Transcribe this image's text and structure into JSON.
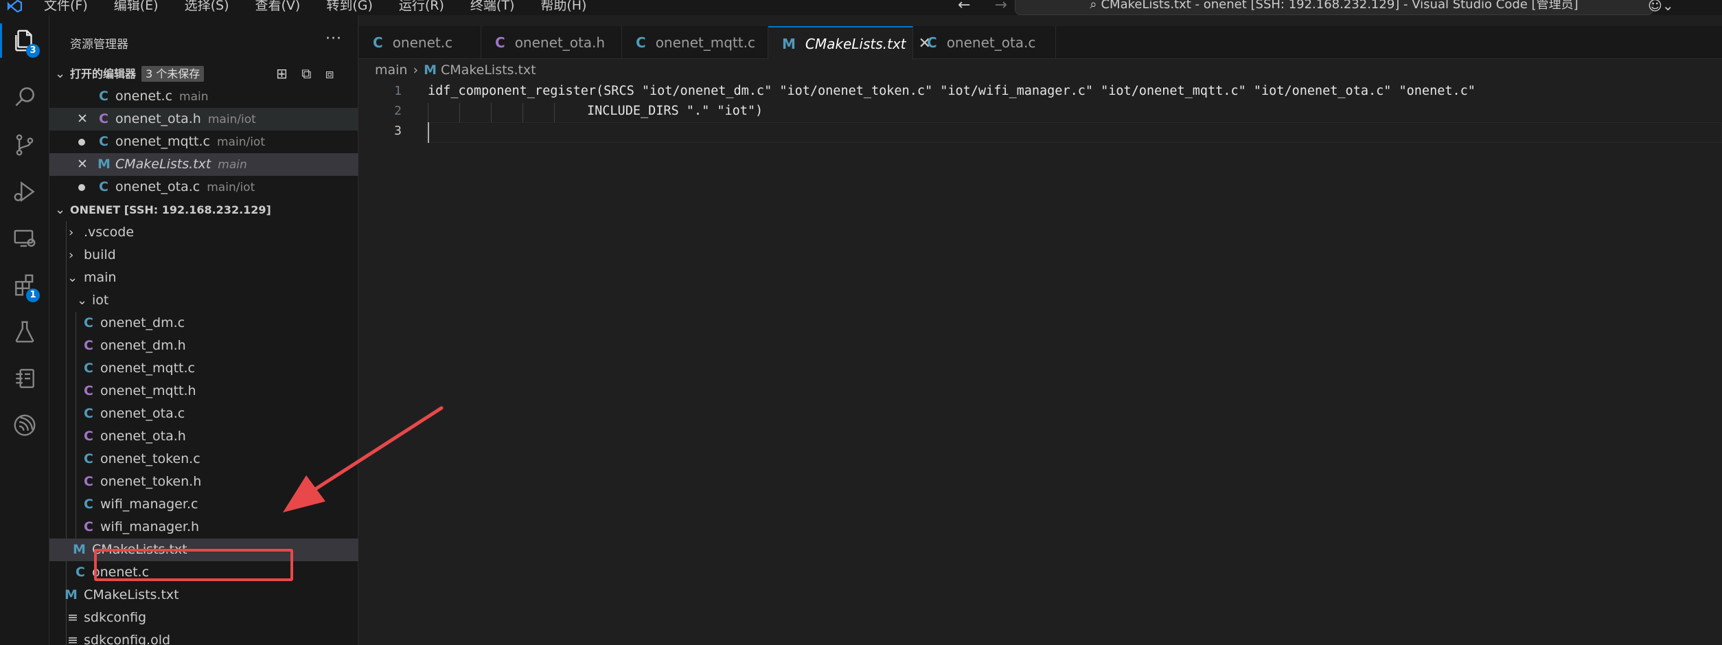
{
  "titlebar": {
    "menu": [
      "文件(F)",
      "编辑(E)",
      "选择(S)",
      "查看(V)",
      "转到(G)",
      "运行(R)",
      "终端(T)",
      "帮助(H)"
    ],
    "command_center": "CMakeLists.txt - onenet [SSH: 192.168.232.129] - Visual Studio Code [管理员]"
  },
  "activity": {
    "explorer_badge": "3",
    "extensions_badge": "1"
  },
  "sidebar": {
    "title": "资源管理器",
    "more": "···",
    "open_editors": {
      "label": "打开的编辑器",
      "unsaved": "3 个未保存",
      "items": [
        {
          "name": "onenet.c",
          "desc": "main"
        },
        {
          "name": "onenet_ota.h",
          "desc": "main/iot"
        },
        {
          "name": "onenet_mqtt.c",
          "desc": "main/iot"
        },
        {
          "name": "CMakeLists.txt",
          "desc": "main"
        },
        {
          "name": "onenet_ota.c",
          "desc": "main/iot"
        }
      ]
    },
    "workspace": {
      "label": "ONENET [SSH: 192.168.232.129]",
      "tree": [
        {
          "name": ".vscode"
        },
        {
          "name": "build"
        },
        {
          "name": "main"
        },
        {
          "name": "iot"
        },
        {
          "name": "onenet_dm.c"
        },
        {
          "name": "onenet_dm.h"
        },
        {
          "name": "onenet_mqtt.c"
        },
        {
          "name": "onenet_mqtt.h"
        },
        {
          "name": "onenet_ota.c"
        },
        {
          "name": "onenet_ota.h"
        },
        {
          "name": "onenet_token.c"
        },
        {
          "name": "onenet_token.h"
        },
        {
          "name": "wifi_manager.c"
        },
        {
          "name": "wifi_manager.h"
        },
        {
          "name": "CMakeLists.txt"
        },
        {
          "name": "onenet.c"
        },
        {
          "name": "CMakeLists.txt"
        },
        {
          "name": "sdkconfig"
        },
        {
          "name": "sdkconfig.old"
        }
      ]
    }
  },
  "tabs": [
    {
      "name": "onenet.c"
    },
    {
      "name": "onenet_ota.h"
    },
    {
      "name": "onenet_mqtt.c"
    },
    {
      "name": "CMakeLists.txt"
    },
    {
      "name": "onenet_ota.c"
    }
  ],
  "breadcrumb": {
    "folder": "main",
    "file": "CMakeLists.txt"
  },
  "editor": {
    "lines": [
      {
        "no": "1",
        "text": "idf_component_register(SRCS \"iot/onenet_dm.c\" \"iot/onenet_token.c\" \"iot/wifi_manager.c\" \"iot/onenet_mqtt.c\" \"iot/onenet_ota.c\" \"onenet.c\""
      },
      {
        "no": "2",
        "text": "INCLUDE_DIRS \".\" \"iot\")"
      },
      {
        "no": "3",
        "text": ""
      }
    ]
  },
  "colors": {
    "accent": "#0078d4",
    "c_icon": "#519aba",
    "h_icon": "#a074c4",
    "annotation_red": "#e8484a"
  },
  "icons": [
    "vscode-logo",
    "files-icon",
    "search-icon",
    "source-control-icon",
    "run-debug-icon",
    "remote-explorer-icon",
    "extensions-icon",
    "testing-icon",
    "docker-icon",
    "esp-idf-icon",
    "copilot-icon"
  ]
}
